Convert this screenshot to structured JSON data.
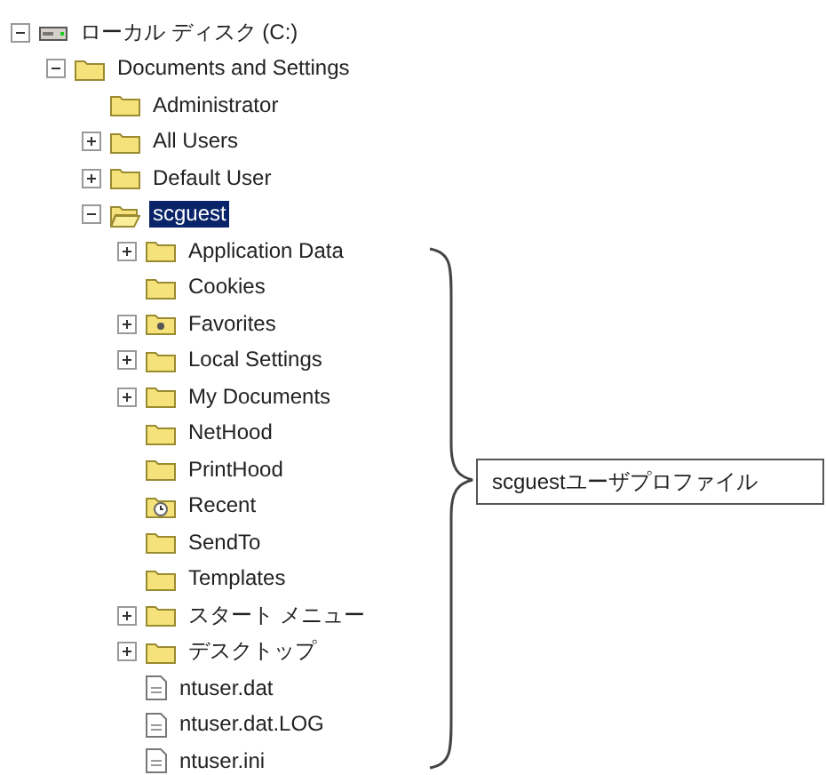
{
  "tree": [
    {
      "label": "ローカル ディスク (C:)",
      "kind": "drive",
      "expanded": true,
      "selected": false,
      "children": [
        {
          "label": "Documents and Settings",
          "kind": "folder",
          "expanded": true,
          "selected": false,
          "children": [
            {
              "label": "Administrator",
              "kind": "folder",
              "selected": false
            },
            {
              "label": "All Users",
              "kind": "folder",
              "expanded": false,
              "selected": false
            },
            {
              "label": "Default User",
              "kind": "folder",
              "expanded": false,
              "selected": false
            },
            {
              "label": "scguest",
              "kind": "open",
              "expanded": true,
              "selected": true,
              "children": [
                {
                  "label": "Application Data",
                  "kind": "folder",
                  "expanded": false,
                  "selected": false
                },
                {
                  "label": "Cookies",
                  "kind": "folder",
                  "selected": false
                },
                {
                  "label": "Favorites",
                  "kind": "favorites",
                  "expanded": false,
                  "selected": false
                },
                {
                  "label": "Local Settings",
                  "kind": "folder",
                  "expanded": false,
                  "selected": false
                },
                {
                  "label": "My Documents",
                  "kind": "folder",
                  "expanded": false,
                  "selected": false
                },
                {
                  "label": "NetHood",
                  "kind": "folder",
                  "selected": false
                },
                {
                  "label": "PrintHood",
                  "kind": "folder",
                  "selected": false
                },
                {
                  "label": "Recent",
                  "kind": "recent",
                  "selected": false
                },
                {
                  "label": "SendTo",
                  "kind": "folder",
                  "selected": false
                },
                {
                  "label": "Templates",
                  "kind": "folder",
                  "selected": false
                },
                {
                  "label": "スタート メニュー",
                  "kind": "folder",
                  "expanded": false,
                  "selected": false
                },
                {
                  "label": "デスクトップ",
                  "kind": "folder",
                  "expanded": false,
                  "selected": false
                },
                {
                  "label": "ntuser.dat",
                  "kind": "file",
                  "selected": false
                },
                {
                  "label": "ntuser.dat.LOG",
                  "kind": "file",
                  "selected": false
                },
                {
                  "label": "ntuser.ini",
                  "kind": "file",
                  "selected": false
                }
              ]
            }
          ]
        }
      ]
    }
  ],
  "callout": {
    "text": "scguestユーザプロファイル"
  }
}
